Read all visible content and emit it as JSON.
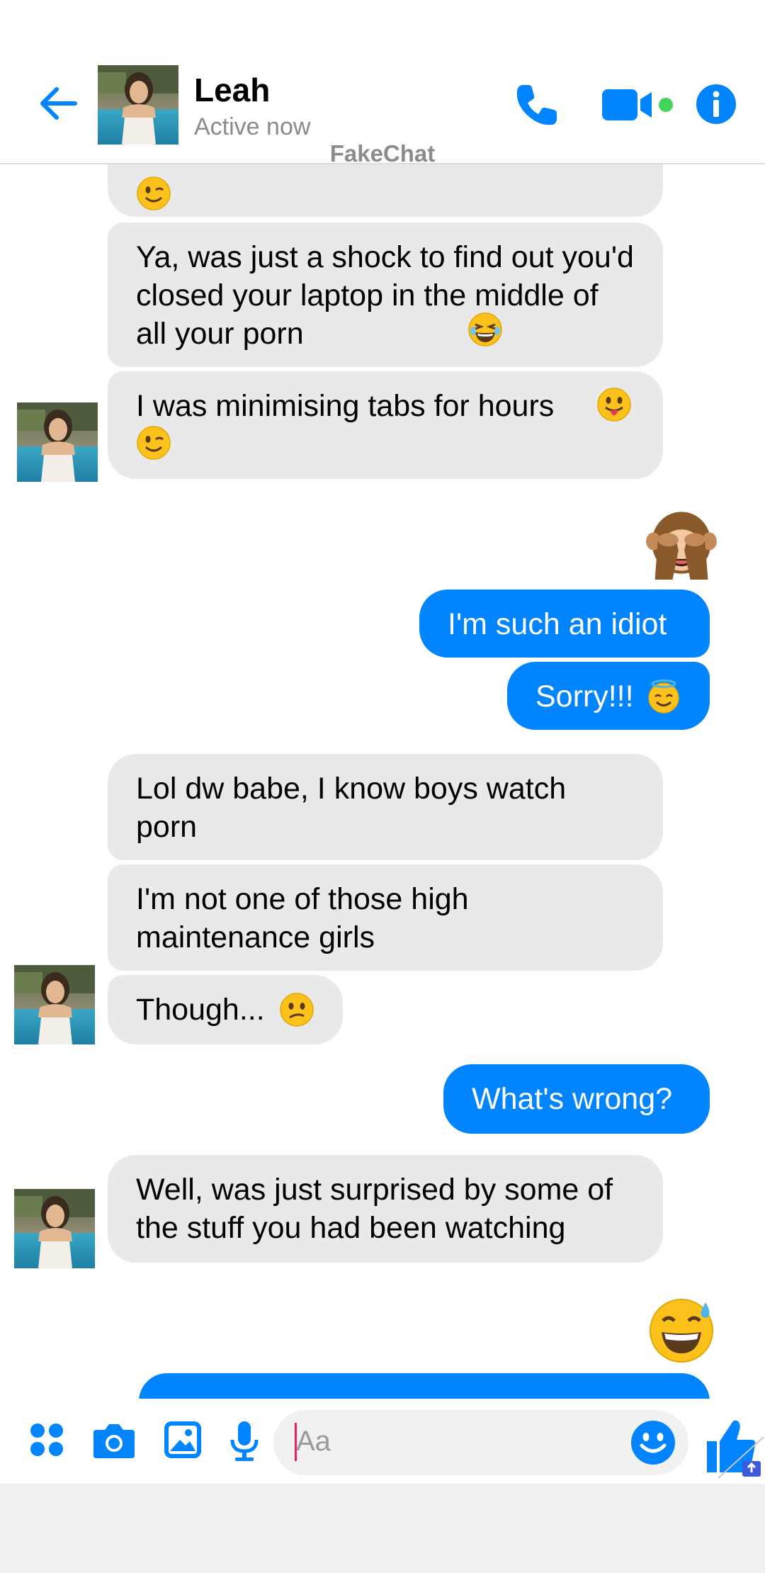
{
  "header": {
    "contact_name": "Leah",
    "status": "Active now",
    "watermark": "FakeChat"
  },
  "messages": [
    {
      "side": "in",
      "text": "Ya, was just a shock to find out you'd closed your laptop in the middle of all your porn"
    },
    {
      "side": "in",
      "text": "I was minimising tabs for hours"
    },
    {
      "side": "out",
      "text": "I'm such an idiot"
    },
    {
      "side": "out",
      "text": "Sorry!!!"
    },
    {
      "side": "in",
      "text": "Lol dw babe, I know boys watch porn"
    },
    {
      "side": "in",
      "text": "I'm not one of those high maintenance girls"
    },
    {
      "side": "in",
      "text": "Though..."
    },
    {
      "side": "out",
      "text": "What's wrong?"
    },
    {
      "side": "in",
      "text": "Well, was just surprised by some of the stuff you had been watching"
    }
  ],
  "composer": {
    "placeholder": "Aa"
  },
  "colors": {
    "accent": "#0084ff",
    "incoming_bubble": "#e9e9e9",
    "online_dot": "#44d45c"
  },
  "icons": [
    "back-arrow-icon",
    "phone-icon",
    "video-camera-icon",
    "info-icon",
    "apps-icon",
    "camera-icon",
    "image-icon",
    "microphone-icon",
    "smiley-icon",
    "thumbs-up-icon"
  ]
}
